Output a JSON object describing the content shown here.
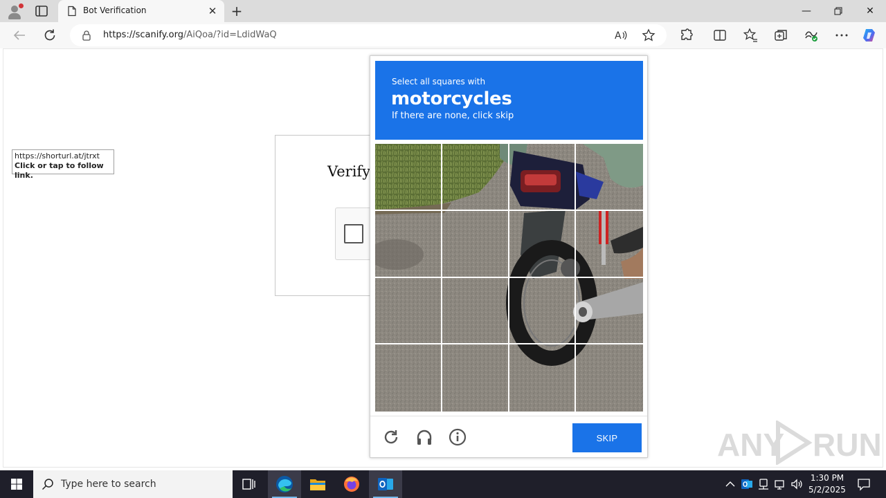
{
  "browser": {
    "tab_title": "Bot Verification",
    "url_domain": "https://scanify.org",
    "url_path": "/AiQoa/?id=LdidWaQ"
  },
  "page": {
    "heading": "Verifyi",
    "link_tooltip": {
      "url": "https://shorturl.at/jtrxt",
      "hint": "Click or tap to follow link."
    }
  },
  "captcha": {
    "instruction": "Select all squares with",
    "target": "motorcycles",
    "subtext": "If there are none, click skip",
    "skip_label": "SKIP",
    "header_color": "#1a73e8",
    "grid_rows": 4,
    "grid_cols": 4
  },
  "watermark": {
    "text_left": "ANY",
    "text_right": "RUN"
  },
  "taskbar": {
    "search_placeholder": "Type here to search",
    "time": "1:30 PM",
    "date": "5/2/2025"
  },
  "icons": [
    "profile-icon",
    "tab-actions-icon",
    "page-icon",
    "close-icon",
    "plus-icon",
    "back-icon",
    "refresh-icon",
    "lock-icon",
    "read-aloud-icon",
    "favorite-star-icon",
    "extensions-icon",
    "split-screen-icon",
    "favorites-icon",
    "collections-icon",
    "browser-essentials-icon",
    "more-icon",
    "copilot-icon",
    "reload-icon",
    "headphones-icon",
    "info-icon",
    "windows-icon",
    "search-icon",
    "task-view-icon",
    "edge-icon",
    "file-explorer-icon",
    "firefox-icon",
    "outlook-icon"
  ]
}
